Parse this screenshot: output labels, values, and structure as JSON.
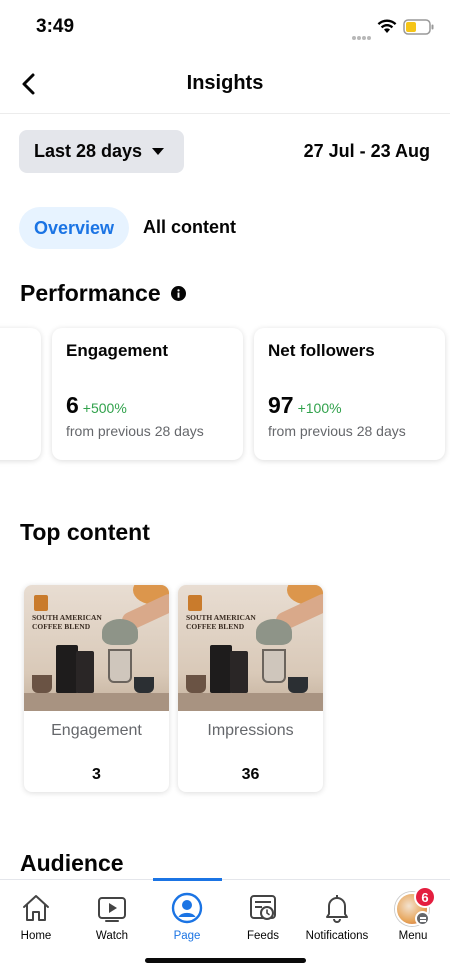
{
  "status_bar": {
    "time": "3:49"
  },
  "header": {
    "title": "Insights"
  },
  "date_filter": {
    "range_label": "Last 28 days",
    "date_range": "27 Jul - 23 Aug"
  },
  "tabs": [
    {
      "label": "Overview",
      "active": true
    },
    {
      "label": "All content",
      "active": false
    }
  ],
  "performance": {
    "title": "Performance",
    "cards": [
      {
        "label": "Engagement",
        "value": "6",
        "change": "+500%",
        "subtitle": "from previous 28 days"
      },
      {
        "label": "Net followers",
        "value": "97",
        "change": "+100%",
        "subtitle": "from previous 28 days"
      }
    ]
  },
  "top_content": {
    "title": "Top content",
    "post_image_text": "SOUTH AMERICAN COFFEE BLEND",
    "posts": [
      {
        "metric": "Engagement",
        "value": "3"
      },
      {
        "metric": "Impressions",
        "value": "36"
      }
    ]
  },
  "audience": {
    "title": "Audience"
  },
  "bottom_nav": {
    "items": [
      {
        "label": "Home",
        "icon": "home-icon"
      },
      {
        "label": "Watch",
        "icon": "watch-icon"
      },
      {
        "label": "Page",
        "icon": "page-icon",
        "active": true
      },
      {
        "label": "Feeds",
        "icon": "feeds-icon"
      },
      {
        "label": "Notifications",
        "icon": "bell-icon"
      },
      {
        "label": "Menu",
        "icon": "menu-avatar-icon",
        "badge": "6"
      }
    ]
  },
  "colors": {
    "accent": "#1b74e4",
    "positive": "#31a24c",
    "badge": "#e41e3f",
    "muted": "#65676b"
  }
}
